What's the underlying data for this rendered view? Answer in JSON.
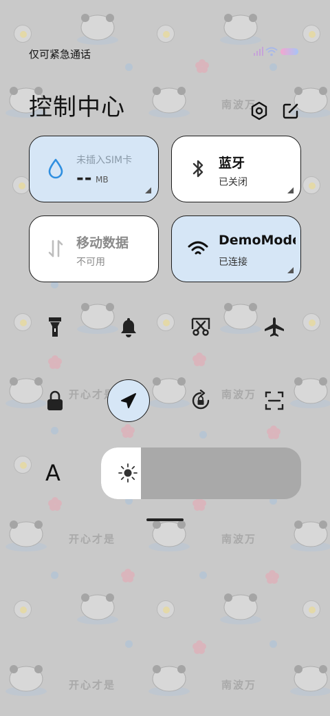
{
  "status_bar": {
    "carrier_text": "仅可紧急通话"
  },
  "header": {
    "title": "控制中心",
    "settings_icon": "settings-hexagon-icon",
    "edit_icon": "edit-icon"
  },
  "tiles": [
    {
      "id": "sim",
      "top": "未插入SIM卡",
      "value": "--",
      "unit": "MB",
      "state": "on",
      "color": "#d6e6f6"
    },
    {
      "id": "bluetooth",
      "label": "蓝牙",
      "status": "已关闭",
      "state": "off"
    },
    {
      "id": "mobile-data",
      "label": "移动数据",
      "status": "不可用",
      "state": "disabled"
    },
    {
      "id": "wifi",
      "label": "DemoMode",
      "status": "已连接",
      "state": "on",
      "color": "#d6e6f6"
    }
  ],
  "quick_toggles": [
    {
      "name": "flashlight-icon",
      "active": false
    },
    {
      "name": "bell-icon",
      "active": false
    },
    {
      "name": "screenshot-icon",
      "active": false
    },
    {
      "name": "airplane-icon",
      "active": false
    },
    {
      "name": "lock-icon",
      "active": false
    },
    {
      "name": "location-icon",
      "active": true
    },
    {
      "name": "rotation-lock-icon",
      "active": false
    },
    {
      "name": "scan-icon",
      "active": false
    }
  ],
  "brightness": {
    "font_size_label": "A",
    "level": 0.2
  },
  "wallpaper": {
    "texts": [
      "开心才是",
      "南波万"
    ]
  }
}
